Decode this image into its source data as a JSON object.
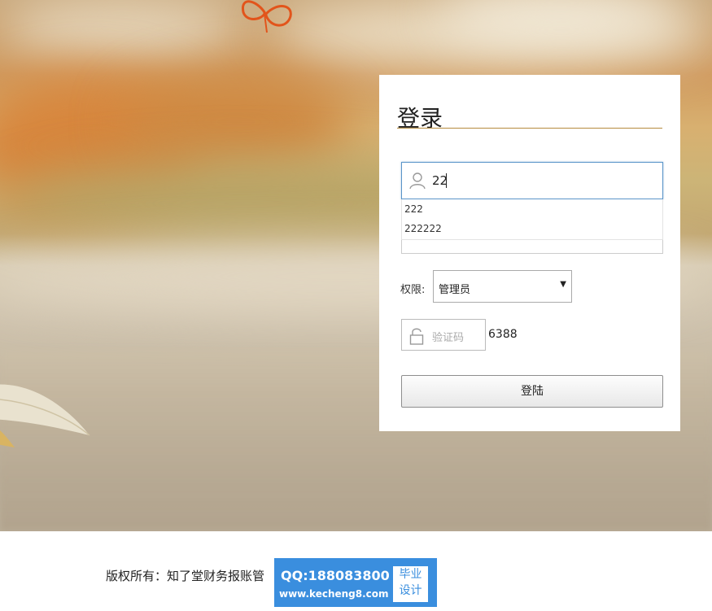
{
  "login": {
    "title": "登录",
    "username_value": "22",
    "suggestions": [
      "222",
      "222222"
    ],
    "role_label": "权限:",
    "role_selected": "管理员",
    "captcha_placeholder": "验证码",
    "captcha_code": "6388",
    "submit_label": "登陆"
  },
  "footer": {
    "copyright": "版权所有：知了堂财务报账管"
  },
  "watermark": {
    "qq": "QQ:188083800",
    "site": "www.kecheng8.com",
    "badge_line1": "毕业",
    "badge_line2": "设计"
  },
  "icons": {
    "user": "user-icon",
    "lock": "lock-icon",
    "dropdown": "chevron-down-icon"
  },
  "colors": {
    "accent_line": "#b58b3e",
    "focus_border": "#5b95c9",
    "watermark_bg": "#3a8ede"
  }
}
